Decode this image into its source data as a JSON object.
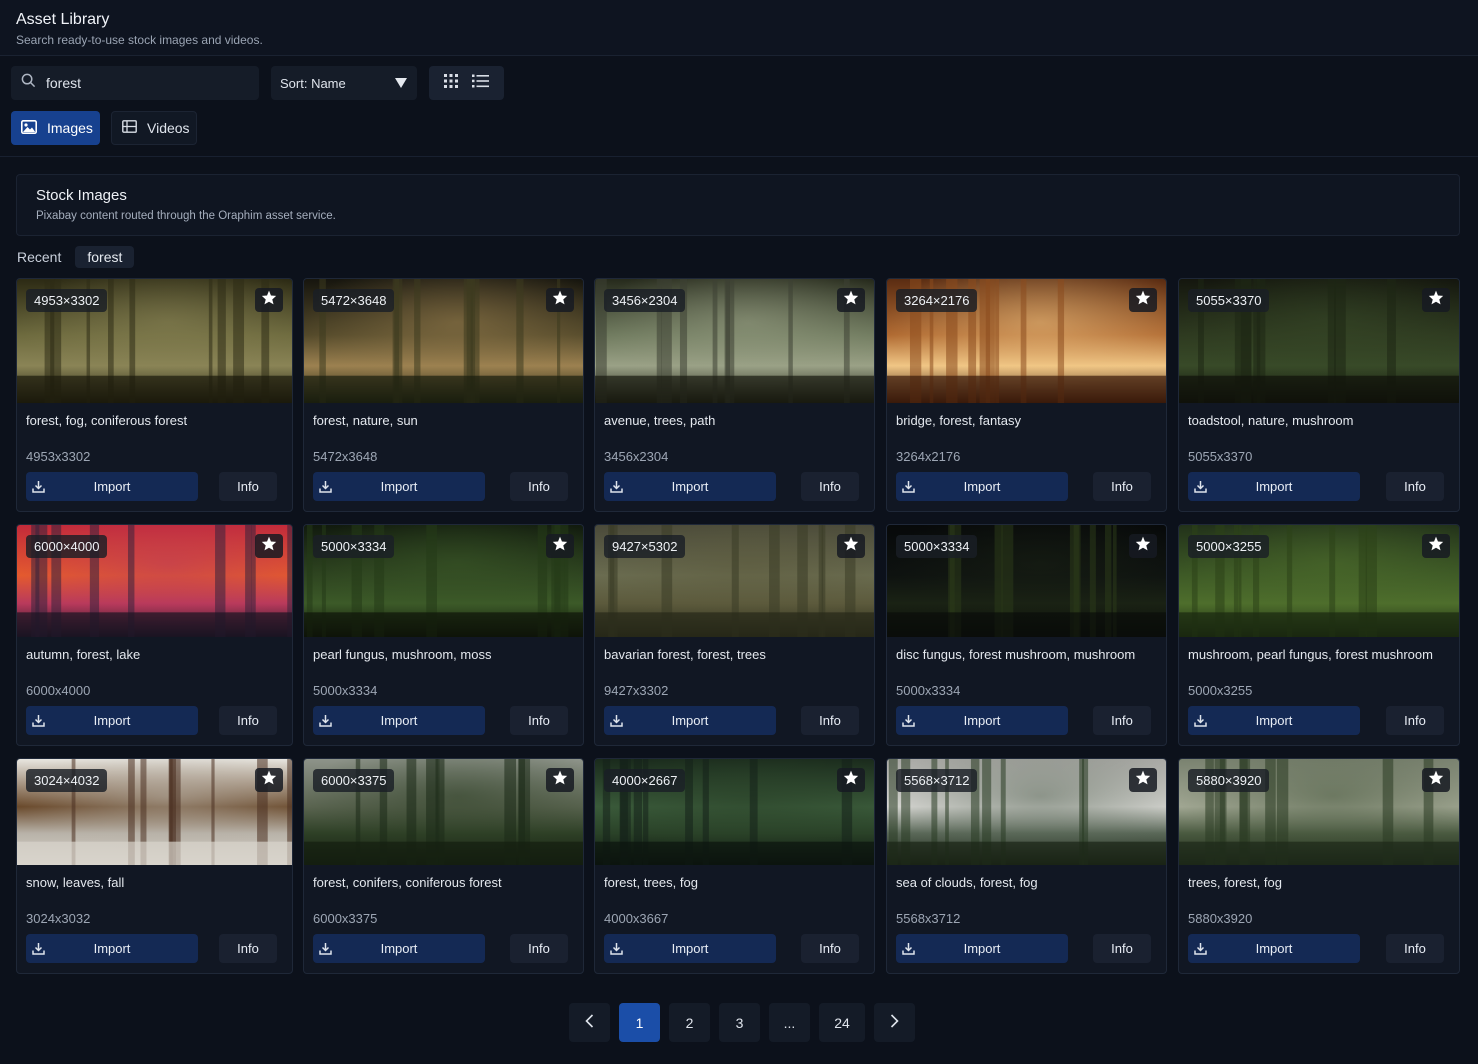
{
  "app": {
    "title": "Asset Library",
    "subtitle": "Search ready-to-use stock images and videos."
  },
  "search": {
    "value": "forest",
    "placeholder": ""
  },
  "sort": {
    "label": "Sort: Name"
  },
  "tabs": [
    {
      "label": "Images",
      "active": true
    },
    {
      "label": "Videos",
      "active": false
    }
  ],
  "section": {
    "title": "Stock Images",
    "subtitle": "Pixabay content routed through the Oraphim asset service."
  },
  "filters": {
    "recent": "Recent",
    "active_chip": "forest"
  },
  "buttons": {
    "import": "Import",
    "info": "Info"
  },
  "cards": [
    {
      "badge": "4953×3302",
      "title": "forest, fog, coniferous forest",
      "dims": "4953x3302"
    },
    {
      "badge": "5472×3648",
      "title": "forest, nature, sun",
      "dims": "5472x3648"
    },
    {
      "badge": "3456×2304",
      "title": "avenue, trees, path",
      "dims": "3456x2304"
    },
    {
      "badge": "3264×2176",
      "title": "bridge, forest, fantasy",
      "dims": "3264x2176"
    },
    {
      "badge": "5055×3370",
      "title": "toadstool, nature, mushroom",
      "dims": "5055x3370"
    },
    {
      "badge": "6000×4000",
      "title": "autumn, forest, lake",
      "dims": "6000x4000"
    },
    {
      "badge": "5000×3334",
      "title": "pearl fungus, mushroom, moss",
      "dims": "5000x3334"
    },
    {
      "badge": "9427×5302",
      "title": "bavarian forest, forest, trees",
      "dims": "9427x3302"
    },
    {
      "badge": "5000×3334",
      "title": "disc fungus, forest mushroom, mushroom",
      "dims": "5000x3334"
    },
    {
      "badge": "5000×3255",
      "title": "mushroom, pearl fungus, forest mushroom",
      "dims": "5000x3255"
    },
    {
      "badge": "3024×4032",
      "title": "snow, leaves, fall",
      "dims": "3024x3032"
    },
    {
      "badge": "6000×3375",
      "title": "forest, conifers, coniferous forest",
      "dims": "6000x3375"
    },
    {
      "badge": "4000×2667",
      "title": "forest, trees, fog",
      "dims": "4000x3667"
    },
    {
      "badge": "5568×3712",
      "title": "sea of clouds, forest, fog",
      "dims": "5568x3712"
    },
    {
      "badge": "5880×3920",
      "title": "trees, forest, fog",
      "dims": "5880x3920"
    }
  ],
  "pagination": {
    "pages": [
      "1",
      "2",
      "3",
      "...",
      "24"
    ],
    "current": "1"
  },
  "colors": {
    "background": "#0c111b",
    "accent": "#17418f",
    "import_button": "#142954",
    "active_page": "#1b4ea8"
  }
}
